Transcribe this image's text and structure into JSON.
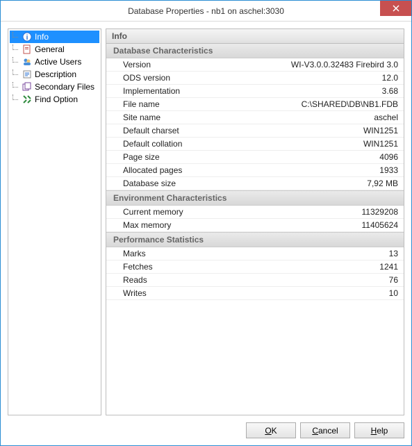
{
  "window": {
    "title": "Database Properties - nb1 on aschel:3030"
  },
  "nav": {
    "items": [
      {
        "label": "Info",
        "icon": "info"
      },
      {
        "label": "General",
        "icon": "general"
      },
      {
        "label": "Active Users",
        "icon": "users"
      },
      {
        "label": "Description",
        "icon": "desc"
      },
      {
        "label": "Secondary Files",
        "icon": "files"
      },
      {
        "label": "Find Option",
        "icon": "find"
      }
    ]
  },
  "content": {
    "title": "Info",
    "sections": [
      {
        "title": "Database Characteristics",
        "rows": [
          {
            "label": "Version",
            "value": "WI-V3.0.0.32483 Firebird 3.0"
          },
          {
            "label": "ODS version",
            "value": "12.0"
          },
          {
            "label": "Implementation",
            "value": "3.68"
          },
          {
            "label": "File name",
            "value": "C:\\SHARED\\DB\\NB1.FDB"
          },
          {
            "label": "Site name",
            "value": "aschel"
          },
          {
            "label": "Default charset",
            "value": "WIN1251"
          },
          {
            "label": "Default collation",
            "value": "WIN1251"
          },
          {
            "label": "Page size",
            "value": "4096"
          },
          {
            "label": "Allocated pages",
            "value": "1933"
          },
          {
            "label": "Database size",
            "value": "7,92 MB"
          }
        ]
      },
      {
        "title": "Environment Characteristics",
        "rows": [
          {
            "label": "Current memory",
            "value": "11329208"
          },
          {
            "label": "Max memory",
            "value": "11405624"
          }
        ]
      },
      {
        "title": "Performance Statistics",
        "rows": [
          {
            "label": "Marks",
            "value": "13"
          },
          {
            "label": "Fetches",
            "value": "1241"
          },
          {
            "label": "Reads",
            "value": "76"
          },
          {
            "label": "Writes",
            "value": "10"
          }
        ]
      }
    ]
  },
  "buttons": {
    "ok": "OK",
    "cancel": "Cancel",
    "help": "Help"
  }
}
